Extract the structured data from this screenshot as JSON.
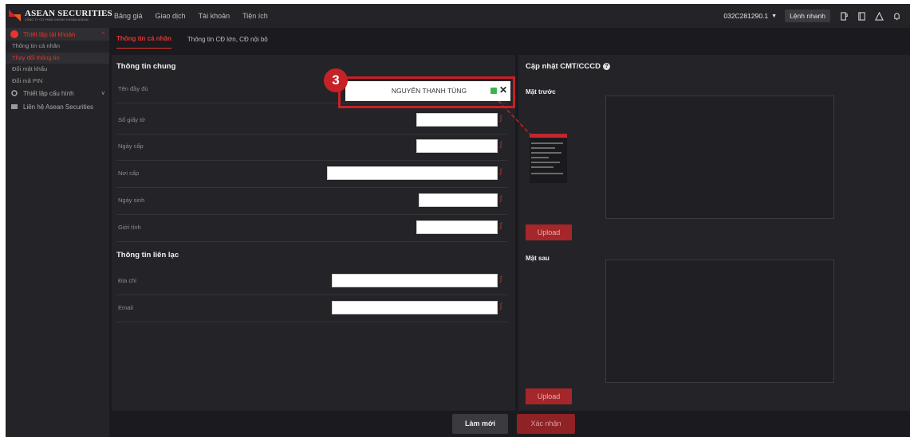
{
  "brand": {
    "name": "ASEAN SECURITIES",
    "sub": "CÔNG TY CỔ PHẦN CHỨNG KHOÁN ASEAN",
    "accent": "#e5352f"
  },
  "topnav": {
    "items": [
      "Bảng giá",
      "Giao dịch",
      "Tài khoản",
      "Tiện ích"
    ],
    "account": "032C281290.1",
    "quick_order": "Lệnh nhanh"
  },
  "sidebar": {
    "group_account": "Thiết lập tài khoản",
    "items": [
      "Thông tin cá nhân",
      "Thay đổi thông tin",
      "Đổi mật khẩu",
      "Đổi mã PIN"
    ],
    "group_config": "Thiết lập cấu hình",
    "contact": "Liên hệ Asean Securities"
  },
  "tabs": [
    "Thông tin cá nhân",
    "Thông tin CĐ lớn, CĐ nội bộ"
  ],
  "general": {
    "title": "Thông tin chung",
    "fields": [
      "Tên đầy đủ",
      "Số giấy tờ",
      "Ngày cấp",
      "Nơi cấp",
      "Ngày sinh",
      "Giới tính"
    ]
  },
  "contact_info": {
    "title": "Thông tin liên lạc",
    "fields": [
      "Địa chỉ",
      "Email"
    ]
  },
  "id_update": {
    "title": "Cập nhật CMT/CCCD",
    "front": "Mặt trước",
    "back": "Mặt sau",
    "upload": "Upload"
  },
  "actions": {
    "reset": "Làm mới",
    "confirm": "Xác nhận"
  },
  "annotation": {
    "step": "3",
    "full_name": "NGUYỄN THANH TÙNG",
    "color": "#c62127"
  }
}
